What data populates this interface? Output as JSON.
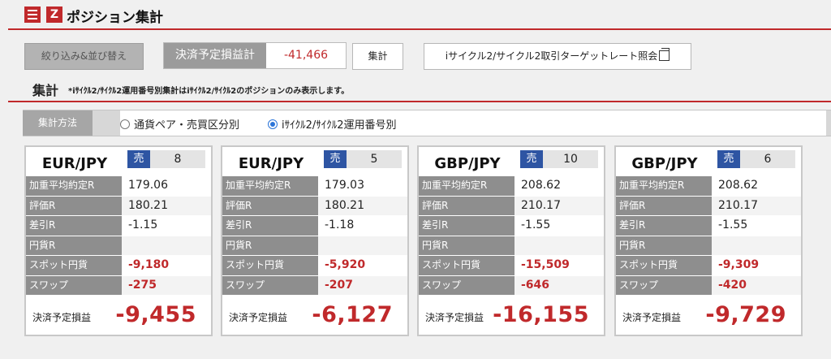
{
  "header": {
    "title": "ポジション集計",
    "icons": [
      "menu-icon",
      "z-logo-icon"
    ],
    "z_char": "Z"
  },
  "toolbar": {
    "filter_sort_label": "絞り込み&並び替え",
    "total_label": "決済予定損益計",
    "total_value": "-41,466",
    "aggregate_label": "集計",
    "inquiry_label": "iサイクル2/サイクル2取引ターゲットレート照会"
  },
  "section": {
    "title": "集計",
    "note": "*iｻｲｸﾙ2/ｻｲｸﾙ2運用番号別集計はiｻｲｸﾙ2/ｻｲｸﾙ2のポジションのみ表示します。"
  },
  "method": {
    "label": "集計方法",
    "options": [
      "通貨ペア・売買区分別",
      "iｻｲｸﾙ2/ｻｲｸﾙ2運用番号別"
    ],
    "selected_index": 1
  },
  "labels": {
    "avg_rate": "加重平均約定R",
    "eval_rate": "評価R",
    "diff_rate": "差引R",
    "yen_rate": "円貨R",
    "spot_yen": "スポット円貨",
    "swap": "スワップ",
    "planned_pl": "決済予定損益"
  },
  "colors": {
    "accent_red": "#c0292b",
    "sell_blue": "#2e55a3"
  },
  "cards": [
    {
      "pair": "EUR/JPY",
      "side": "売",
      "qty": "8",
      "avg_rate": "179.06",
      "eval_rate": "180.21",
      "diff_rate": "-1.15",
      "yen_rate": "",
      "spot_yen": "-9,180",
      "swap": "-275",
      "planned_pl": "-9,455"
    },
    {
      "pair": "EUR/JPY",
      "side": "売",
      "qty": "5",
      "avg_rate": "179.03",
      "eval_rate": "180.21",
      "diff_rate": "-1.18",
      "yen_rate": "",
      "spot_yen": "-5,920",
      "swap": "-207",
      "planned_pl": "-6,127"
    },
    {
      "pair": "GBP/JPY",
      "side": "売",
      "qty": "10",
      "avg_rate": "208.62",
      "eval_rate": "210.17",
      "diff_rate": "-1.55",
      "yen_rate": "",
      "spot_yen": "-15,509",
      "swap": "-646",
      "planned_pl": "-16,155"
    },
    {
      "pair": "GBP/JPY",
      "side": "売",
      "qty": "6",
      "avg_rate": "208.62",
      "eval_rate": "210.17",
      "diff_rate": "-1.55",
      "yen_rate": "",
      "spot_yen": "-9,309",
      "swap": "-420",
      "planned_pl": "-9,729"
    }
  ]
}
